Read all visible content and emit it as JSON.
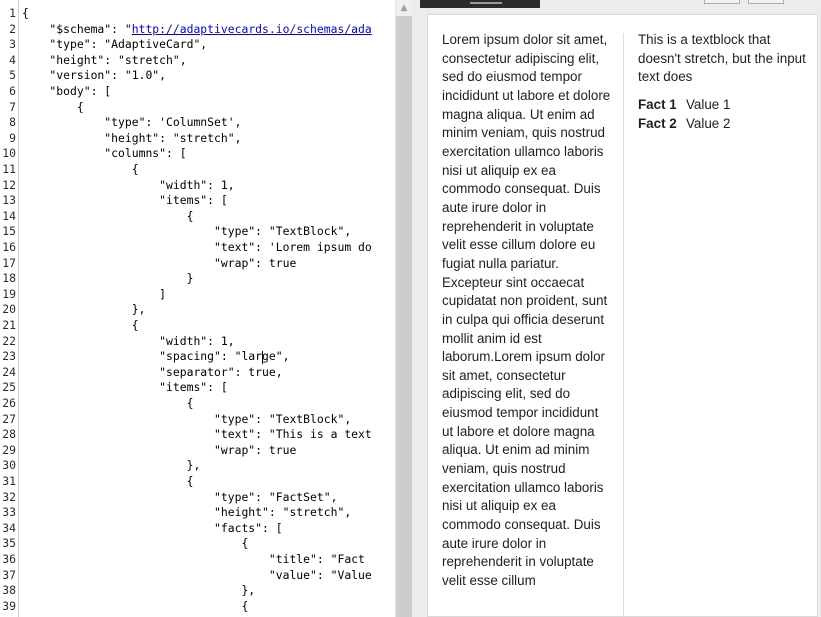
{
  "toolbar": {
    "buttons": [
      "",
      "",
      ""
    ]
  },
  "editor": {
    "lines": [
      {
        "n": "1",
        "text": "{"
      },
      {
        "n": "2",
        "pre": "    \"$schema\": \"",
        "link": "http://adaptivecards.io/schemas/ada"
      },
      {
        "n": "3",
        "text": "    \"type\": \"AdaptiveCard\","
      },
      {
        "n": "4",
        "text": "    \"height\": \"stretch\","
      },
      {
        "n": "5",
        "text": "    \"version\": \"1.0\","
      },
      {
        "n": "6",
        "text": "    \"body\": ["
      },
      {
        "n": "7",
        "text": "        {"
      },
      {
        "n": "8",
        "text": "            \"type\": 'ColumnSet',"
      },
      {
        "n": "9",
        "text": "            \"height\": \"stretch\","
      },
      {
        "n": "10",
        "text": "            \"columns\": ["
      },
      {
        "n": "11",
        "text": "                {"
      },
      {
        "n": "12",
        "text": "                    \"width\": 1,"
      },
      {
        "n": "13",
        "text": "                    \"items\": ["
      },
      {
        "n": "14",
        "text": "                        {"
      },
      {
        "n": "15",
        "text": "                            \"type\": \"TextBlock\","
      },
      {
        "n": "16",
        "text": "                            \"text\": 'Lorem ipsum do"
      },
      {
        "n": "17",
        "text": "                            \"wrap\": true"
      },
      {
        "n": "18",
        "text": "                        }"
      },
      {
        "n": "19",
        "text": "                    ]"
      },
      {
        "n": "20",
        "text": "                },"
      },
      {
        "n": "21",
        "text": "                {"
      },
      {
        "n": "22",
        "text": "                    \"width\": 1,"
      },
      {
        "n": "23",
        "text": "                    \"spacing\": \"large\","
      },
      {
        "n": "24",
        "text": "                    \"separator\": true,"
      },
      {
        "n": "25",
        "text": "                    \"items\": ["
      },
      {
        "n": "26",
        "text": "                        {"
      },
      {
        "n": "27",
        "text": "                            \"type\": \"TextBlock\","
      },
      {
        "n": "28",
        "text": "                            \"text\": \"This is a text"
      },
      {
        "n": "29",
        "text": "                            \"wrap\": true"
      },
      {
        "n": "30",
        "text": "                        },"
      },
      {
        "n": "31",
        "text": "                        {"
      },
      {
        "n": "32",
        "text": "                            \"type\": \"FactSet\","
      },
      {
        "n": "33",
        "text": "                            \"height\": \"stretch\","
      },
      {
        "n": "34",
        "text": "                            \"facts\": ["
      },
      {
        "n": "35",
        "text": "                                {"
      },
      {
        "n": "36",
        "text": "                                    \"title\": \"Fact "
      },
      {
        "n": "37",
        "text": "                                    \"value\": \"Value"
      },
      {
        "n": "38",
        "text": "                                },"
      },
      {
        "n": "39",
        "text": "                                {"
      }
    ]
  },
  "scrollbar": {
    "up_arrow": "▲"
  },
  "card": {
    "column1_text": "Lorem ipsum dolor sit amet, consectetur adipiscing elit, sed do eiusmod tempor incididunt ut labore et dolore magna aliqua. Ut enim ad minim veniam, quis nostrud exercitation ullamco laboris nisi ut aliquip ex ea commodo consequat. Duis aute irure dolor in reprehenderit in voluptate velit esse cillum dolore eu fugiat nulla pariatur. Excepteur sint occaecat cupidatat non proident, sunt in culpa qui officia deserunt mollit anim id est laborum.Lorem ipsum dolor sit amet, consectetur adipiscing elit, sed do eiusmod tempor incididunt ut labore et dolore magna aliqua. Ut enim ad minim veniam, quis nostrud exercitation ullamco laboris nisi ut aliquip ex ea commodo consequat. Duis aute irure dolor in reprehenderit in voluptate velit esse cillum",
    "column2_text": "This is a textblock that doesn't stretch, but the input text does",
    "facts": [
      {
        "title": "Fact 1",
        "value": "Value 1"
      },
      {
        "title": "Fact 2",
        "value": "Value 2"
      }
    ]
  }
}
